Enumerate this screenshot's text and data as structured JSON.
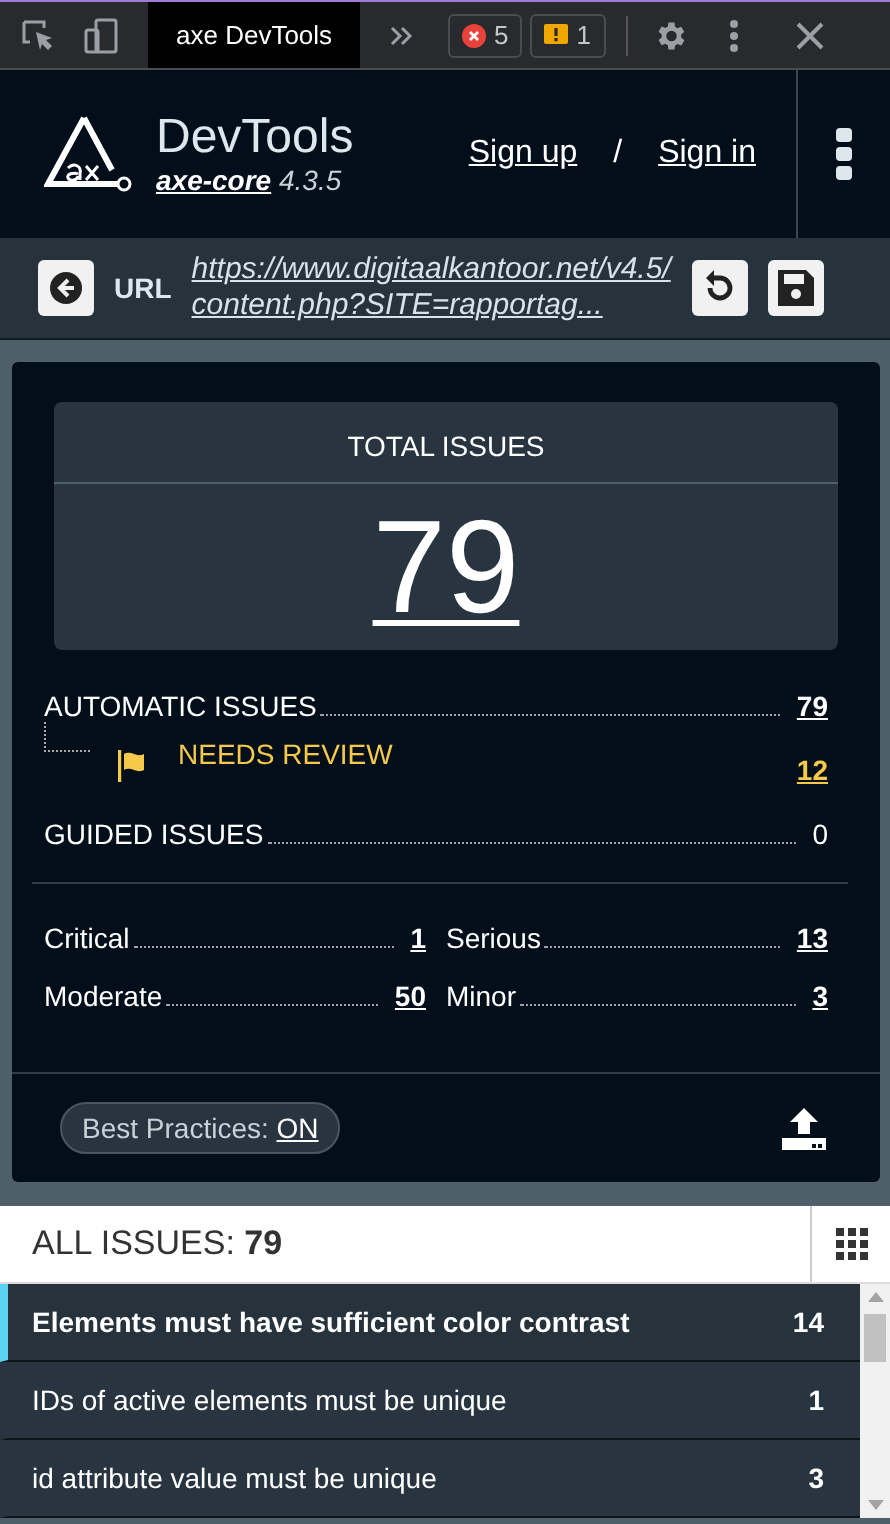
{
  "devtools_bar": {
    "tab": "axe DevTools",
    "errors": "5",
    "warnings": "1"
  },
  "header": {
    "title": "DevTools",
    "core_link": "axe-core",
    "version": "4.3.5",
    "sign_up": "Sign up",
    "separator": "/",
    "sign_in": "Sign in"
  },
  "url_bar": {
    "label": "URL",
    "url": "https://www.digitaalkantoor.net/v4.5/content.php?SITE=rapportag..."
  },
  "summary": {
    "total_label": "TOTAL ISSUES",
    "total": "79",
    "automatic": {
      "label": "AUTOMATIC ISSUES",
      "value": "79"
    },
    "needs_review": {
      "label": "NEEDS REVIEW",
      "value": "12"
    },
    "guided": {
      "label": "GUIDED ISSUES",
      "value": "0"
    },
    "impacts": [
      {
        "label": "Critical",
        "value": "1"
      },
      {
        "label": "Serious",
        "value": "13"
      },
      {
        "label": "Moderate",
        "value": "50"
      },
      {
        "label": "Minor",
        "value": "3"
      }
    ],
    "best_practices": {
      "label": "Best Practices:",
      "value": "ON",
      "on": true
    }
  },
  "all_issues": {
    "label": "ALL ISSUES:",
    "count": "79"
  },
  "issues": [
    {
      "title": "Elements must have sufficient color contrast",
      "count": "14",
      "selected": true
    },
    {
      "title": "IDs of active elements must be unique",
      "count": "1",
      "selected": false
    },
    {
      "title": "id attribute value must be unique",
      "count": "3",
      "selected": false
    }
  ]
}
